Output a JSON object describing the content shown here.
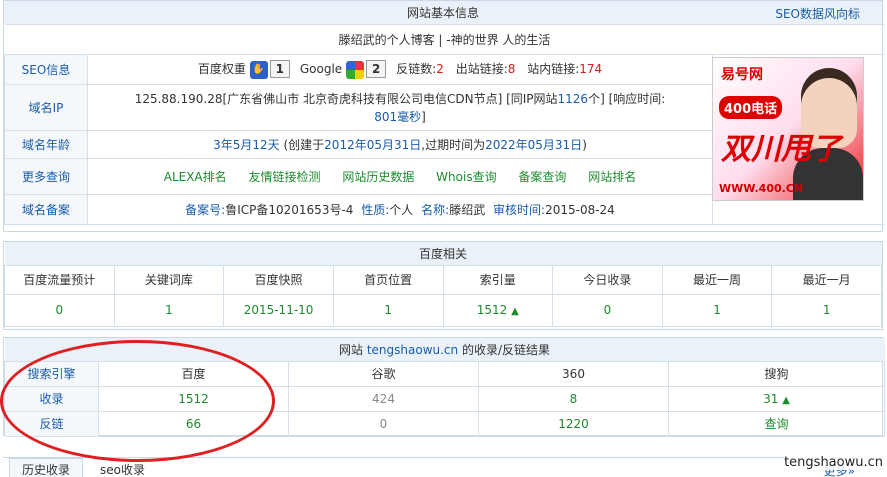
{
  "basic": {
    "title": "网站基本信息",
    "seo_link": "SEO数据风向标",
    "site_title": "滕绍武的个人博客 | -神的世界 人的生活",
    "rows": {
      "seo_label": "SEO信息",
      "baidu_weight_label": "百度权重",
      "baidu_weight_value": "1",
      "google_label": "Google",
      "google_value": "2",
      "backlinks_label": "反链数:",
      "backlinks_value": "2",
      "outlinks_label": "出站链接:",
      "outlinks_value": "8",
      "inlinks_label": "站内链接:",
      "inlinks_value": "174",
      "ip_label": "域名IP",
      "ip_line1_a": "125.88.190.28[广东省佛山市 北京奇虎科技有限公司电信CDN节点] [同IP网站",
      "ip_same_count": "1126",
      "ip_line1_b": "个] [响应时间:",
      "ip_response": "801毫秒",
      "ip_line2_tail": "]",
      "age_label": "域名年龄",
      "age_value": "3年5月12天",
      "age_mid1": "(创建于",
      "age_created": "2012年05月31日",
      "age_mid2": ",过期时间为",
      "age_expire": "2022年05月31日",
      "age_end": ")",
      "more_label": "更多查询",
      "more_links": [
        "ALEXA排名",
        "友情链接检测",
        "网站历史数据",
        "Whois查询",
        "备案查询",
        "网站排名"
      ],
      "icp_label": "域名备案",
      "icp_text": "备案号:",
      "icp_no": "鲁ICP备10201653号-4",
      "icp_nature_label": "性质:",
      "icp_nature": "个人",
      "icp_name_label": "名称:",
      "icp_name": "滕绍武",
      "icp_date_label": "审核时间:",
      "icp_date": "2015-08-24"
    },
    "ad": {
      "brand": "易号网",
      "tel": "400电话",
      "big": "双川甩了",
      "url": "WWW.400.CN"
    }
  },
  "baidu": {
    "title": "百度相关",
    "headers": [
      "百度流量预计",
      "关键词库",
      "百度快照",
      "首页位置",
      "索引量",
      "今日收录",
      "最近一周",
      "最近一月"
    ],
    "values": [
      "0",
      "1",
      "2015-11-10",
      "1",
      "1512",
      "0",
      "1",
      "1"
    ]
  },
  "index": {
    "title_prefix": "网站",
    "domain": "tengshaowu.cn",
    "title_suffix": "的收录/反链结果",
    "headers": [
      "搜索引擎",
      "百度",
      "谷歌",
      "360",
      "搜狗"
    ],
    "rows": [
      {
        "label": "收录",
        "values": [
          "1512",
          "424",
          "8",
          "31"
        ]
      },
      {
        "label": "反链",
        "values": [
          "66",
          "0",
          "1220",
          "查询"
        ]
      }
    ]
  },
  "tabs": {
    "history": "历史收录",
    "seo": "seo收录",
    "more": "更多»"
  },
  "watermark": "tengshaowu.cn"
}
